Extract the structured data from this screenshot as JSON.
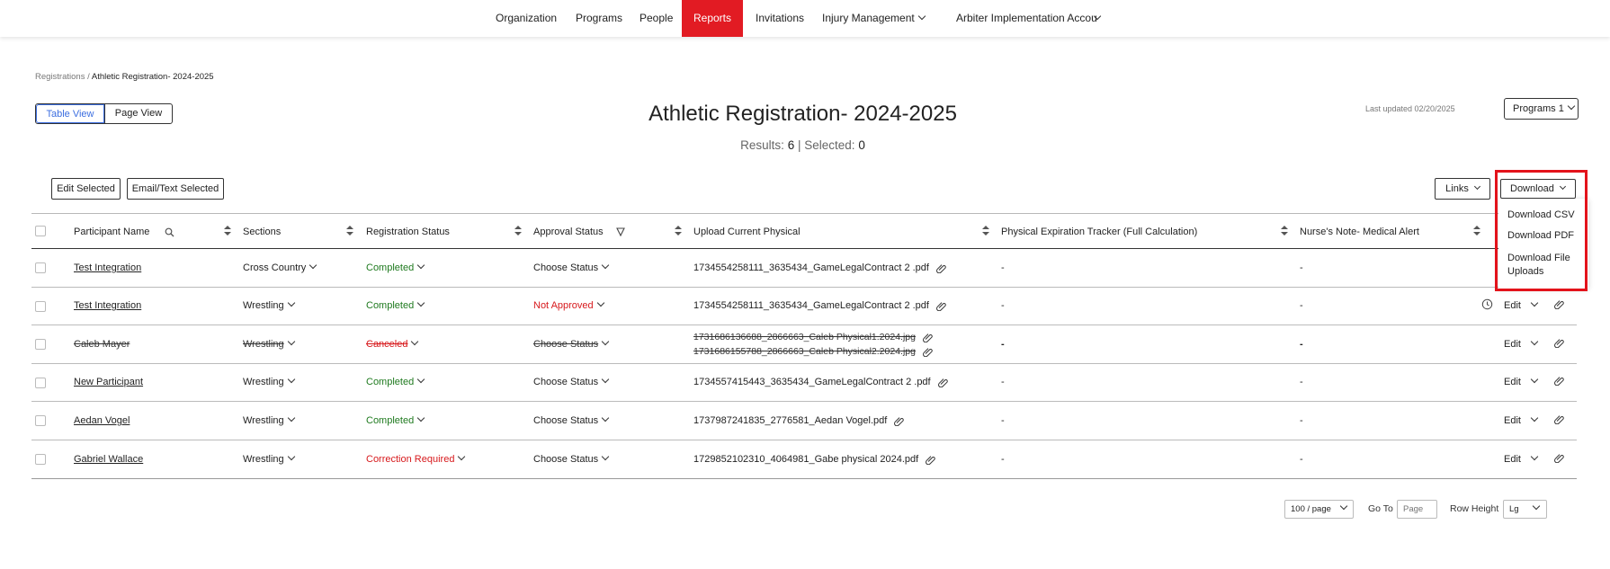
{
  "nav": {
    "items": [
      "Organization",
      "Programs",
      "People",
      "Reports",
      "Invitations",
      "Injury Management",
      "Arbiter Implementation Accou"
    ]
  },
  "breadcrumb": {
    "parent": "Registrations",
    "separator": "/",
    "current": "Athletic Registration- 2024-2025"
  },
  "view_toggle": {
    "table": "Table View",
    "page": "Page View"
  },
  "page_title": "Athletic Registration- 2024-2025",
  "results": {
    "results_label": "Results:",
    "results_count": "6",
    "separator": "|",
    "selected_label": "Selected:",
    "selected_count": "0"
  },
  "last_updated": "Last updated 02/20/2025",
  "programs_button": "Programs 1",
  "toolbar": {
    "edit_selected": "Edit Selected",
    "email_selected": "Email/Text Selected",
    "links": "Links",
    "download": "Download"
  },
  "download_menu": [
    "Download CSV",
    "Download PDF",
    "Download File Uploads"
  ],
  "columns": [
    "Participant Name",
    "Sections",
    "Registration Status",
    "Approval Status",
    "Upload Current Physical",
    "Physical Expiration Tracker (Full Calculation)",
    "Nurse's Note- Medical Alert"
  ],
  "rows": [
    {
      "name": "Test Integration",
      "section": "Cross Country",
      "reg_status": "Completed",
      "approval": "Choose Status",
      "upload": "1734554258111_3635434_GameLegalContract 2 .pdf",
      "expiration": "-",
      "nurse": "-"
    },
    {
      "name": "Test Integration",
      "section": "Wrestling",
      "reg_status": "Completed",
      "approval": "Not Approved",
      "upload": "1734554258111_3635434_GameLegalContract 2 .pdf",
      "expiration": "-",
      "nurse": "-",
      "edit": "Edit"
    },
    {
      "name": "Caleb Mayer",
      "section": "Wrestling",
      "reg_status": "Canceled",
      "approval": "Choose Status",
      "upload": "1731686136688_2866663_Caleb Physical1.2024.jpg",
      "upload2": "1731686155788_2866663_Caleb Physical2.2024.jpg",
      "expiration": "-",
      "nurse": "-",
      "edit": "Edit"
    },
    {
      "name": "New Participant",
      "section": "Wrestling",
      "reg_status": "Completed",
      "approval": "Choose Status",
      "upload": "1734557415443_3635434_GameLegalContract 2 .pdf",
      "expiration": "-",
      "nurse": "-",
      "edit": "Edit"
    },
    {
      "name": "Aedan Vogel",
      "section": "Wrestling",
      "reg_status": "Completed",
      "approval": "Choose Status",
      "upload": "1737987241835_2776581_Aedan Vogel.pdf",
      "expiration": "-",
      "nurse": "-",
      "edit": "Edit"
    },
    {
      "name": "Gabriel Wallace",
      "section": "Wrestling",
      "reg_status": "Correction Required",
      "approval": "Choose Status",
      "upload": "1729852102310_4064981_Gabe physical 2024.pdf",
      "expiration": "-",
      "nurse": "-",
      "edit": "Edit"
    }
  ],
  "pagination": {
    "per_page": "100 / page",
    "goto_label": "Go To",
    "goto_placeholder": "Page",
    "row_height_label": "Row Height",
    "row_height": "Lg"
  },
  "colors": {
    "accent_red": "#e21b23",
    "link_blue": "#3d6fe0",
    "status_green": "#1f7a1f",
    "status_red": "#d7191c"
  }
}
